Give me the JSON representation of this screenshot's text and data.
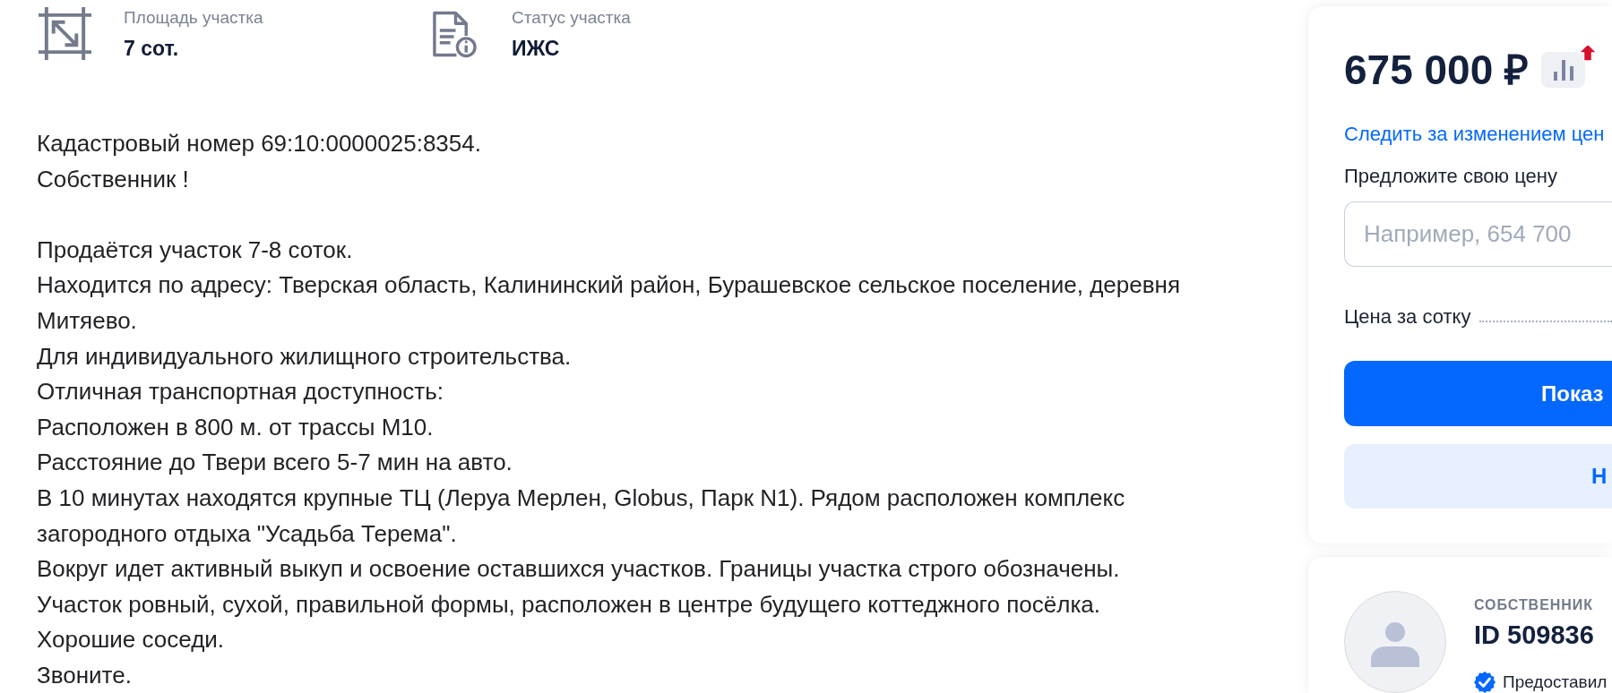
{
  "features": [
    {
      "kind": "area",
      "label": "Площадь участка",
      "value": "7 сот."
    },
    {
      "kind": "status",
      "label": "Статус участка",
      "value": "ИЖС"
    }
  ],
  "description": {
    "paragraphs": [
      [
        "Кадастровый номер 69:10:0000025:8354.",
        "Собственник !"
      ],
      [
        "Продаётся участок 7-8 соток.",
        "Находится по адресу: Тверская область, Калининский район, Бурашевское сельское поселение, деревня Митяево.",
        "Для индивидуального жилищного строительства.",
        "Отличная транспортная доступность:",
        "Расположен в 800 м. от трассы М10.",
        "Расстояние до Твери всего 5-7 мин на авто.",
        "В 10 минутах находятся крупные ТЦ (Леруа Мерлен, Globus, Парк N1). Рядом расположен комплекс загородного отдыха \"Усадьба Терема\".",
        "Вокруг идет активный выкуп и освоение оставшихся участков. Границы участка строго обозначены.",
        "Участок ровный, сухой, правильной формы, расположен в центре будущего коттеджного посёлка.",
        "Хорошие соседи.",
        "Звоните."
      ]
    ]
  },
  "price_card": {
    "price": "675 000 ₽",
    "price_increased": true,
    "track_link": "Следить за изменением цен",
    "offer_label": "Предложите свою цену",
    "offer_placeholder": "Например, 654 700",
    "price_per_sotka_label": "Цена за сотку",
    "buttons": [
      {
        "kind": "primary",
        "label": "Показ"
      },
      {
        "kind": "secondary",
        "label": "Н"
      }
    ]
  },
  "owner_card": {
    "role": "СОБСТВЕННИК",
    "id": "ID 509836",
    "verified": true,
    "verified_text": "Предоставил"
  }
}
